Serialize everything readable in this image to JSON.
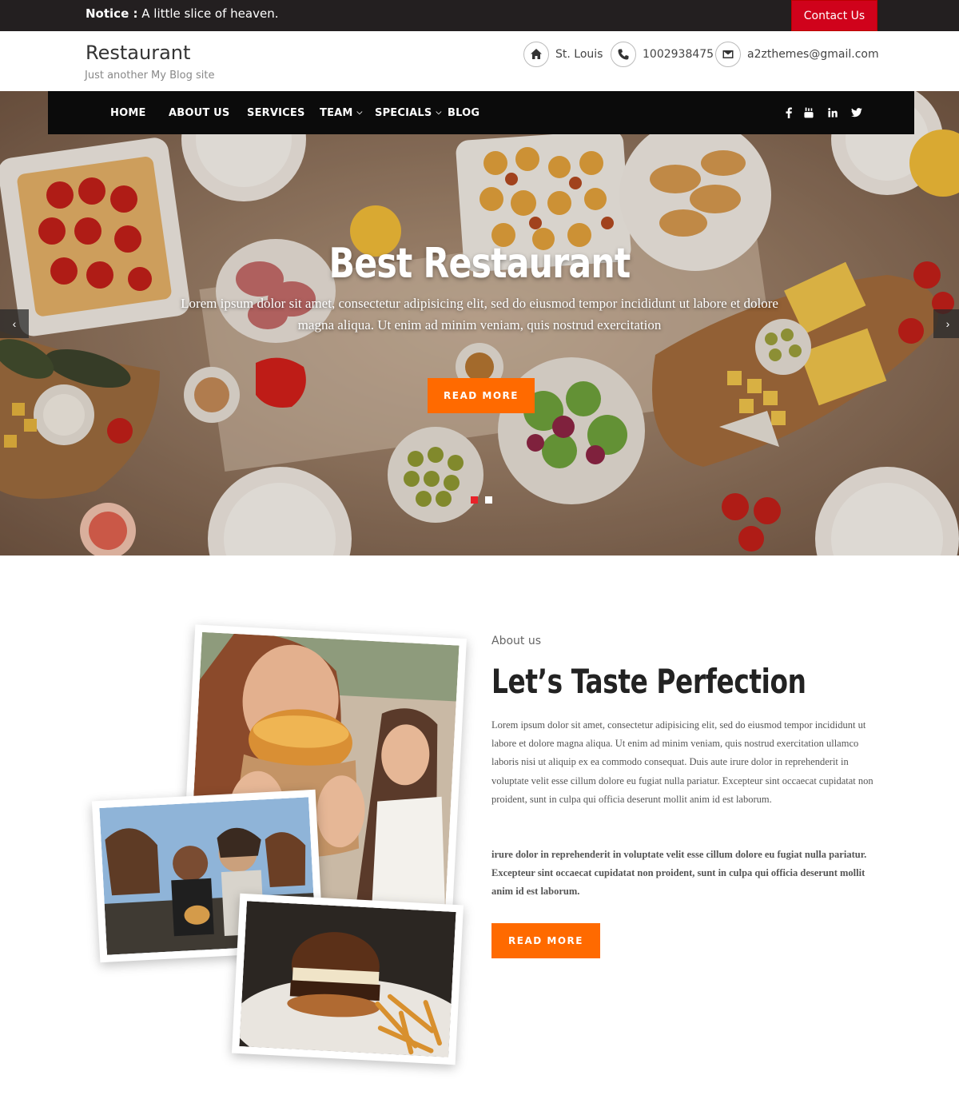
{
  "notice": {
    "label": "Notice :",
    "text": "A little slice of heaven."
  },
  "contact_button": "Contact Us",
  "site": {
    "title": "Restaurant",
    "tagline": "Just another My Blog site"
  },
  "header_info": {
    "location": "St. Louis",
    "phone": "1002938475",
    "email": "a2zthemes@gmail.com"
  },
  "nav": {
    "items": [
      {
        "label": "HOME",
        "dropdown": false
      },
      {
        "label": "ABOUT US",
        "dropdown": false
      },
      {
        "label": "SERVICES",
        "dropdown": false
      },
      {
        "label": "TEAM",
        "dropdown": true
      },
      {
        "label": "SPECIALS",
        "dropdown": true
      },
      {
        "label": "BLOG",
        "dropdown": false
      }
    ],
    "social": [
      "facebook-icon",
      "youtube-icon",
      "linkedin-icon",
      "twitter-icon"
    ]
  },
  "hero": {
    "title": "Best Restaurant",
    "text": "Lorem ipsum dolor sit amet, consectetur adipisicing elit, sed do eiusmod tempor incididunt ut labore et dolore magna aliqua. Ut enim ad minim veniam, quis nostrud exercitation",
    "button": "READ MORE",
    "slides": 2,
    "active_slide": 1
  },
  "about": {
    "eyebrow": "About us",
    "title": "Let’s Taste Perfection",
    "paragraph1": "Lorem ipsum dolor sit amet, consectetur adipisicing elit, sed do eiusmod tempor incididunt ut labore et dolore magna aliqua. Ut enim ad minim veniam, quis nostrud exercitation ullamco laboris nisi ut aliquip ex ea commodo consequat. Duis aute irure dolor in reprehenderit in voluptate velit esse cillum dolore eu fugiat nulla pariatur. Excepteur sint occaecat cupidatat non proident, sunt in culpa qui officia deserunt mollit anim id est laborum.",
    "paragraph2": "irure dolor in reprehenderit in voluptate velit esse cillum dolore eu fugiat nulla pariatur. Excepteur sint occaecat cupidatat non proident, sunt in culpa qui officia deserunt mollit anim id est laborum.",
    "button": "READ MORE"
  },
  "colors": {
    "accent": "#ff6a00",
    "contact": "#d0021b",
    "topbar": "#231f20",
    "nav": "#0b0b0b"
  }
}
